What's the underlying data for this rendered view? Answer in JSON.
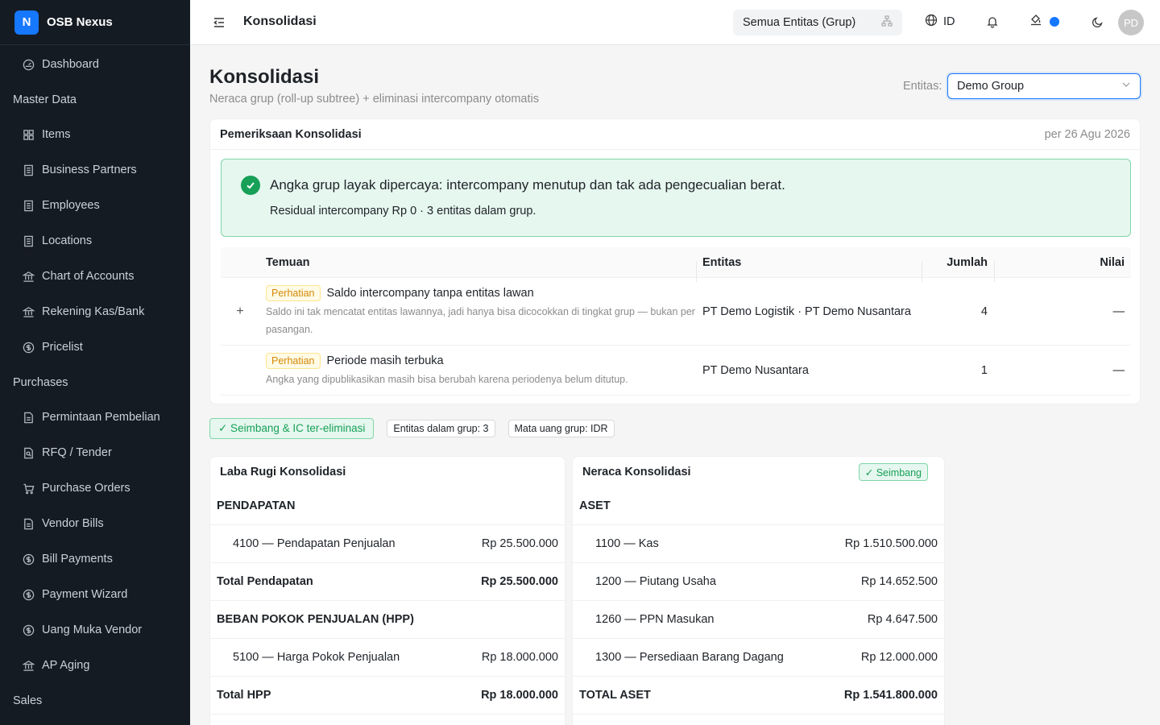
{
  "brand": {
    "logo_letter": "N",
    "name": "OSB Nexus"
  },
  "sidebar": {
    "items": [
      {
        "type": "item",
        "label": "Dashboard",
        "icon": "gauge-icon"
      },
      {
        "type": "section",
        "label": "Master Data"
      },
      {
        "type": "item",
        "label": "Items",
        "icon": "grid-icon"
      },
      {
        "type": "item",
        "label": "Business Partners",
        "icon": "building-icon"
      },
      {
        "type": "item",
        "label": "Employees",
        "icon": "building-icon"
      },
      {
        "type": "item",
        "label": "Locations",
        "icon": "building-icon"
      },
      {
        "type": "item",
        "label": "Chart of Accounts",
        "icon": "bank-icon"
      },
      {
        "type": "item",
        "label": "Rekening Kas/Bank",
        "icon": "bank-icon"
      },
      {
        "type": "item",
        "label": "Pricelist",
        "icon": "dollar-circle-icon"
      },
      {
        "type": "section",
        "label": "Purchases"
      },
      {
        "type": "item",
        "label": "Permintaan Pembelian",
        "icon": "file-icon"
      },
      {
        "type": "item",
        "label": "RFQ / Tender",
        "icon": "file-search-icon"
      },
      {
        "type": "item",
        "label": "Purchase Orders",
        "icon": "cart-icon"
      },
      {
        "type": "item",
        "label": "Vendor Bills",
        "icon": "file-icon"
      },
      {
        "type": "item",
        "label": "Bill Payments",
        "icon": "dollar-circle-icon"
      },
      {
        "type": "item",
        "label": "Payment Wizard",
        "icon": "dollar-circle-icon"
      },
      {
        "type": "item",
        "label": "Uang Muka Vendor",
        "icon": "dollar-circle-icon"
      },
      {
        "type": "item",
        "label": "AP Aging",
        "icon": "bank-icon"
      },
      {
        "type": "section",
        "label": "Sales"
      }
    ]
  },
  "topbar": {
    "title": "Konsolidasi",
    "entity_scope": "Semua Entitas (Grup)",
    "language": "ID",
    "avatar_initials": "PD",
    "accent_color": "#1677ff"
  },
  "page": {
    "title": "Konsolidasi",
    "subtitle": "Neraca grup (roll-up subtree) + eliminasi intercompany otomatis",
    "entity_label": "Entitas:",
    "entity_value": "Demo Group"
  },
  "check": {
    "title": "Pemeriksaan Konsolidasi",
    "date": "per 26 Agu 2026",
    "alert_title": "Angka grup layak dipercaya: intercompany menutup dan tak ada pengecualian berat.",
    "alert_desc": "Residual intercompany Rp 0 · 3 entitas dalam grup.",
    "columns": {
      "finding": "Temuan",
      "entity": "Entitas",
      "count": "Jumlah",
      "value": "Nilai"
    },
    "rows": [
      {
        "tag": "Perhatian",
        "title": "Saldo intercompany tanpa entitas lawan",
        "desc": "Saldo ini tak mencatat entitas lawannya, jadi hanya bisa dicocokkan di tingkat grup — bukan per pasangan.",
        "entity": "PT Demo Logistik · PT Demo Nusantara",
        "count": "4",
        "value": "—"
      },
      {
        "tag": "Perhatian",
        "title": "Periode masih terbuka",
        "desc": "Angka yang dipublikasikan masih bisa berubah karena periodenya belum ditutup.",
        "entity": "PT Demo Nusantara",
        "count": "1",
        "value": "—"
      }
    ]
  },
  "badges": {
    "balanced": "✓ Seimbang & IC ter-eliminasi",
    "entities": "Entitas dalam grup: 3",
    "currency": "Mata uang grup: IDR"
  },
  "pl": {
    "title": "Laba Rugi Konsolidasi",
    "rows": [
      {
        "label": "PENDAPATAN",
        "value": "",
        "kind": "bold"
      },
      {
        "label": "4100 — Pendapatan Penjualan",
        "value": "Rp 25.500.000",
        "kind": "indent"
      },
      {
        "label": "Total Pendapatan",
        "value": "Rp 25.500.000",
        "kind": "bold"
      },
      {
        "label": "BEBAN POKOK PENJUALAN (HPP)",
        "value": "",
        "kind": "bold"
      },
      {
        "label": "5100 — Harga Pokok Penjualan",
        "value": "Rp 18.000.000",
        "kind": "indent"
      },
      {
        "label": "Total HPP",
        "value": "Rp 18.000.000",
        "kind": "bold"
      }
    ]
  },
  "bs": {
    "title": "Neraca Konsolidasi",
    "status": "✓ Seimbang",
    "rows": [
      {
        "label": "ASET",
        "value": "",
        "kind": "bold"
      },
      {
        "label": "1100 — Kas",
        "value": "Rp 1.510.500.000",
        "kind": "indent"
      },
      {
        "label": "1200 — Piutang Usaha",
        "value": "Rp 14.652.500",
        "kind": "indent"
      },
      {
        "label": "1260 — PPN Masukan",
        "value": "Rp 4.647.500",
        "kind": "indent"
      },
      {
        "label": "1300 — Persediaan Barang Dagang",
        "value": "Rp 12.000.000",
        "kind": "indent"
      },
      {
        "label": "TOTAL ASET",
        "value": "Rp 1.541.800.000",
        "kind": "bold"
      }
    ]
  }
}
